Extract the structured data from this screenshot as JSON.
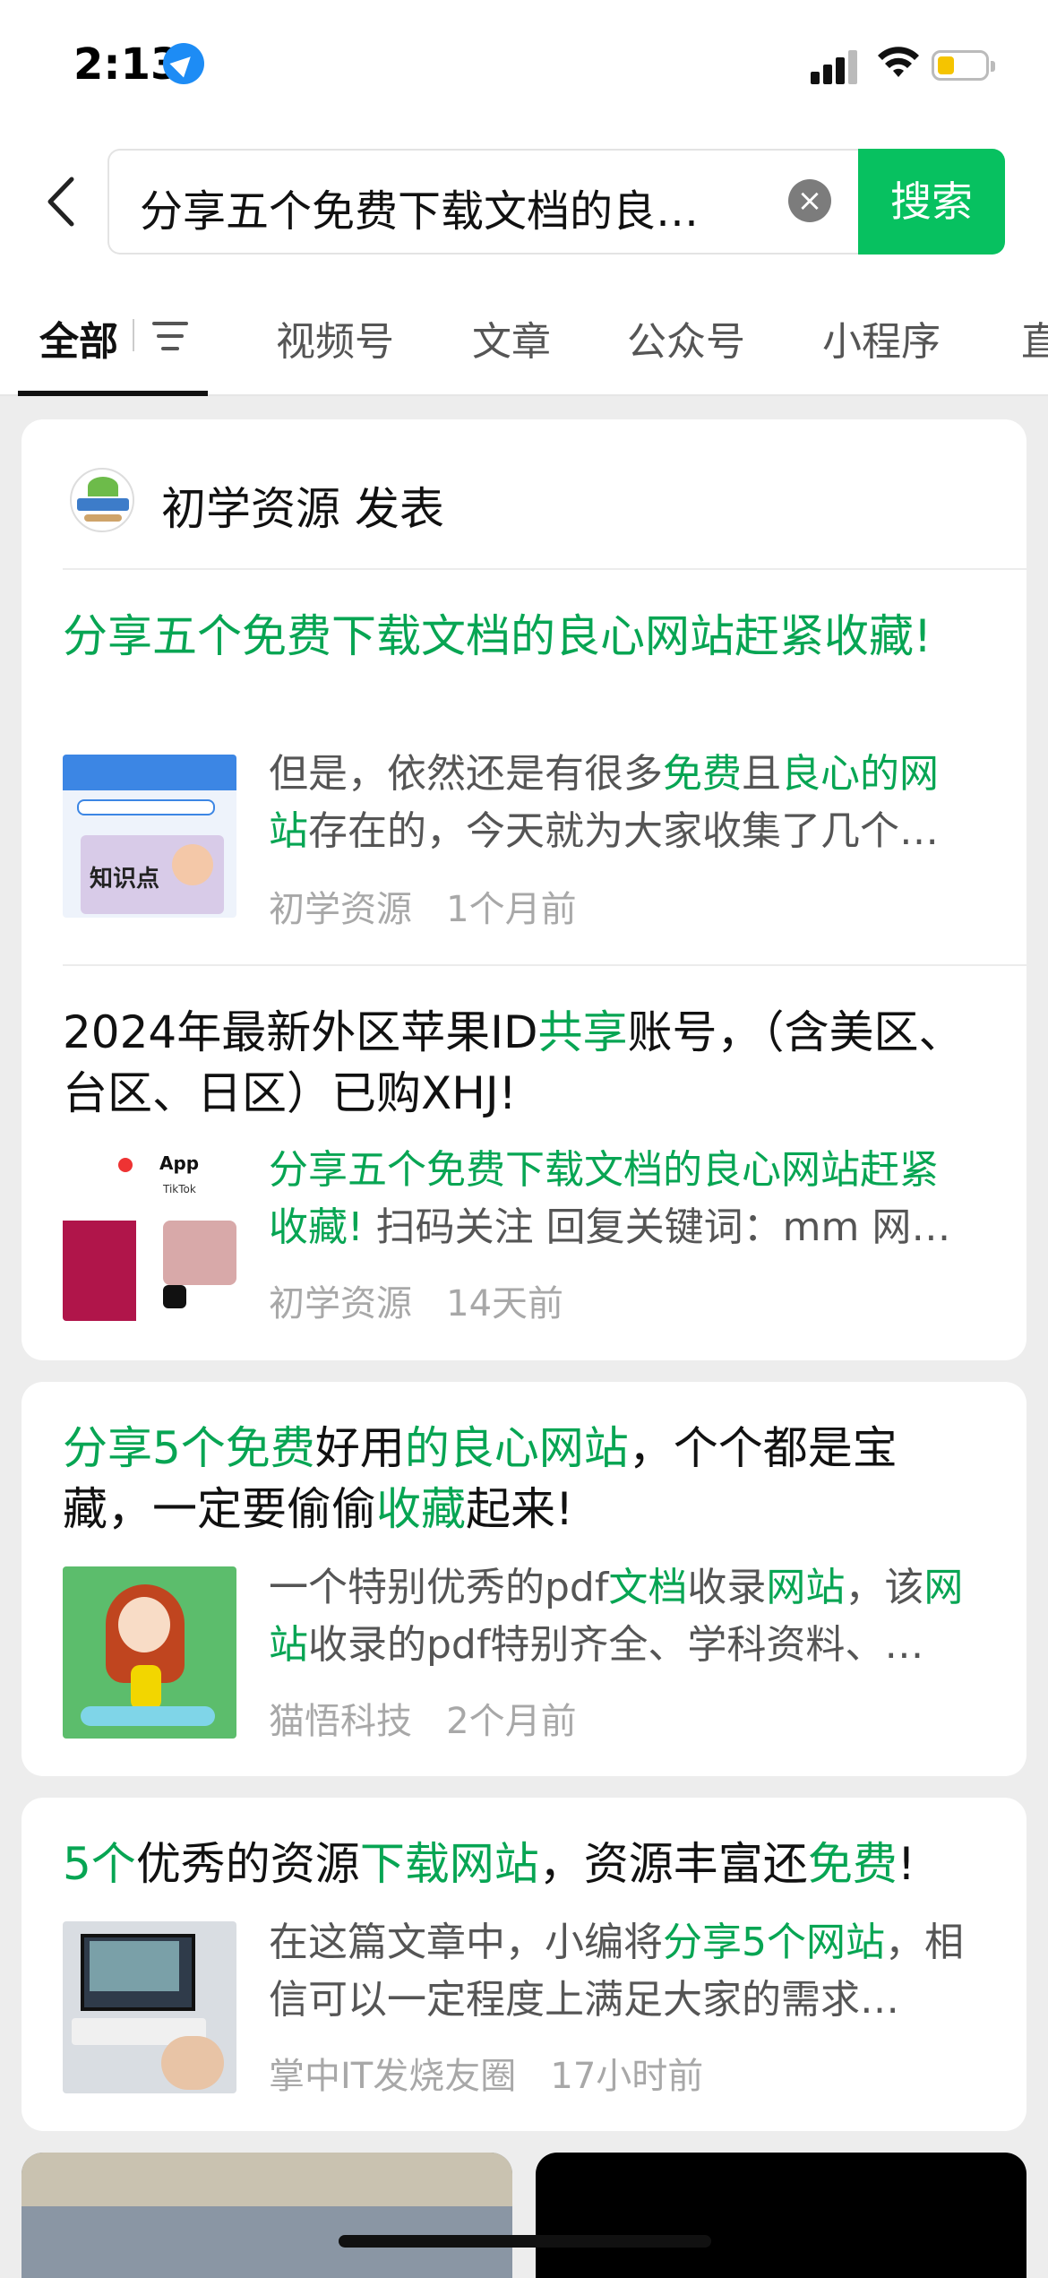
{
  "status_bar": {
    "time": "2:13"
  },
  "search": {
    "query": "分享五个免费下载文档的良…",
    "clear_symbol": "×",
    "button_label": "搜索"
  },
  "tabs": [
    {
      "label": "全部"
    },
    {
      "label": "视频号"
    },
    {
      "label": "文章"
    },
    {
      "label": "公众号"
    },
    {
      "label": "小程序"
    },
    {
      "label": "直"
    }
  ],
  "account_card": {
    "account_name": "初学资源 发表",
    "items": [
      {
        "title_parts": [
          "分享五个免费下载文档的良心网站赶紧收藏!"
        ],
        "snippet_parts": [
          "但是，依然还是有很多",
          "免费",
          "且",
          "良心的网站",
          "存在的，今天就为大家收集了几个…"
        ],
        "thumb_label": "知识点",
        "source": "初学资源",
        "time": "1个月前"
      },
      {
        "title_parts": [
          "2024年最新外区苹果ID",
          "共享",
          "账号，（含美区、台区、日区）已购XHJ!"
        ],
        "snippet_parts": [
          "分享五个免费下载文档的良心网站赶紧收藏!",
          "扫码关注 回复关键词：mm 网…"
        ],
        "thumb_app_label": "App",
        "thumb_tiktok_label": "TikTok",
        "source": "初学资源",
        "time": "14天前"
      }
    ]
  },
  "articles": [
    {
      "title_parts": [
        "分享5个免费",
        "好用",
        "的良心网站",
        "，个个都是宝藏，一定要偷偷",
        "收藏",
        "起来!"
      ],
      "snippet_parts": [
        "一个特别优秀的pdf",
        "文档",
        "收录",
        "网站",
        "，该",
        "网站",
        "收录的pdf特别齐全、学科资料、…"
      ],
      "source": "猫悟科技",
      "time": "2个月前"
    },
    {
      "title_parts": [
        "5个",
        "优秀的资源",
        "下载网站",
        "，资源丰富还",
        "免费",
        "!"
      ],
      "snippet_parts": [
        "在这篇文章中，小编将",
        "分享5个网站",
        "，相信可以一定程度上满足大家的需求…"
      ],
      "source": "掌中IT发烧友圈",
      "time": "17小时前"
    }
  ],
  "colors": {
    "accent": "#07c160",
    "highlight": "#07a553"
  }
}
